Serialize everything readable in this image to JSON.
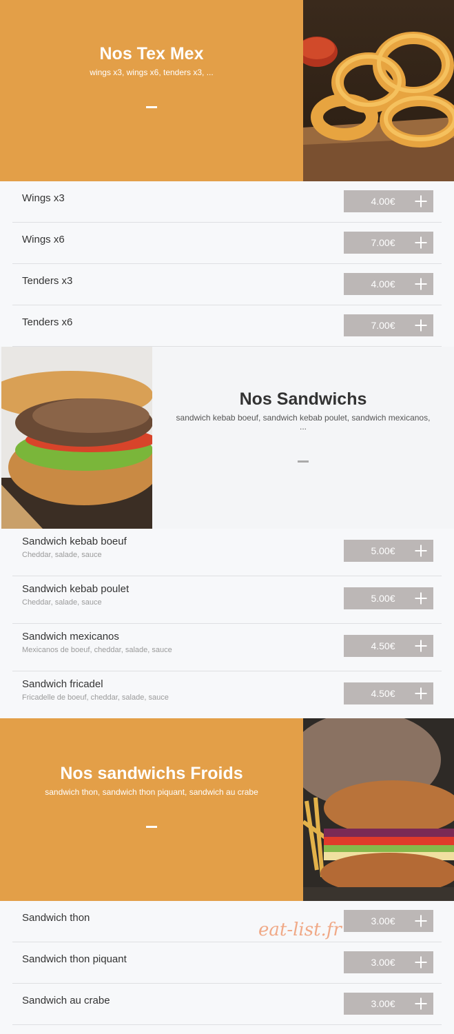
{
  "sections": [
    {
      "title": "Nos Tex Mex",
      "subtitle": "wings x3, wings x6, tenders x3, ...",
      "image": "onion-rings-photo",
      "items": [
        {
          "name": "Wings x3",
          "price": "4.00€"
        },
        {
          "name": "Wings x6",
          "price": "7.00€"
        },
        {
          "name": "Tenders x3",
          "price": "4.00€"
        },
        {
          "name": "Tenders x6",
          "price": "7.00€"
        }
      ]
    },
    {
      "title": "Nos Sandwichs",
      "subtitle": "sandwich kebab boeuf, sandwich kebab poulet, sandwich mexicanos, ...",
      "image": "kebab-sandwich-photo",
      "items": [
        {
          "name": "Sandwich kebab boeuf",
          "desc": "Cheddar, salade, sauce",
          "price": "5.00€"
        },
        {
          "name": "Sandwich kebab poulet",
          "desc": "Cheddar, salade, sauce",
          "price": "5.00€"
        },
        {
          "name": "Sandwich mexicanos",
          "desc": "Mexicanos de boeuf, cheddar, salade, sauce",
          "price": "4.50€"
        },
        {
          "name": "Sandwich fricadel",
          "desc": "Fricadelle de boeuf, cheddar, salade, sauce",
          "price": "4.50€"
        }
      ]
    },
    {
      "title": "Nos sandwichs Froids",
      "subtitle": "sandwich thon, sandwich thon piquant, sandwich au crabe",
      "image": "cold-sandwich-photo",
      "items": [
        {
          "name": "Sandwich thon",
          "price": "3.00€"
        },
        {
          "name": "Sandwich thon piquant",
          "price": "3.00€"
        },
        {
          "name": "Sandwich au crabe",
          "price": "3.00€"
        }
      ]
    }
  ],
  "watermark": "eat-list.fr",
  "colors": {
    "accent": "#e39f48",
    "price_button": "#bcb7b6",
    "page_bg": "#f7f8fa"
  },
  "icons": {
    "add": "plus-icon"
  }
}
